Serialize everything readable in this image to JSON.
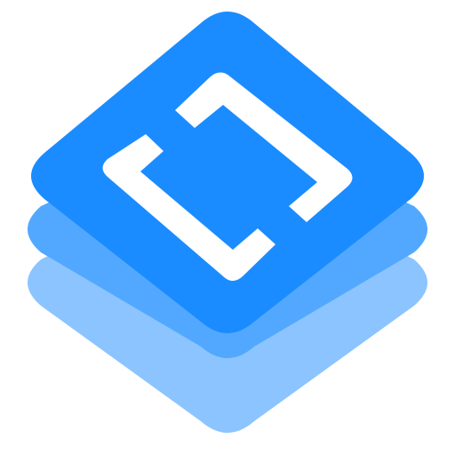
{
  "app_icon": {
    "icon": "stacked-layers-bracket-icon",
    "layers": [
      {
        "role": "bottom-layer",
        "color": "#8CC4FF"
      },
      {
        "role": "middle-layer",
        "color": "#52A8FF"
      },
      {
        "role": "top-layer",
        "color": "#1A8CFF"
      }
    ],
    "glyph": {
      "name": "bracket-frame-icon",
      "color": "#FFFFFF"
    },
    "background": "#FFFFFF"
  }
}
